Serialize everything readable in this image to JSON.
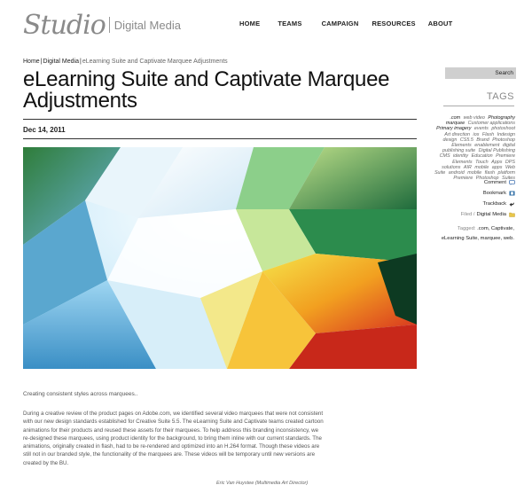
{
  "header": {
    "logo_script": "Studio",
    "logo_text": "Digital Media",
    "nav": [
      "HOME",
      "TEAMS",
      "CAMPAIGN",
      "RESOURCES",
      "ABOUT"
    ]
  },
  "breadcrumb": {
    "home": "Home",
    "section": "Digital Media",
    "current": "eLearning Suite and Captivate Marquee Adjustments"
  },
  "post": {
    "title": "eLearning Suite and Captivate Marquee Adjustments",
    "date": "Dec 14, 2011",
    "caption": "Creating consistent styles across marquees..",
    "body": "During a creative review of the product pages on Adobe.com, we identified several video marquees that were not consistent with our new design standards established for Creative Suite 5.5. The eLearning Suite and Captivate teams created cartoon animations for their products and reused these assets for their marquees. To help address this branding inconsistency, we re-designed these marquees, using product identity for the background, to bring them inline with our current standards. The animations, originally created in flash, had to be re-rendered and optimized into an H.264 format. Though these videos are still not in our branded style, the functionality of the marquees are. These videos will be temporary until new versions are created by the BU.",
    "credit": "Eric Van Huystee (Multimedia Art Director)"
  },
  "sidebar": {
    "search_label": "Search",
    "search_placeholder": "",
    "tags_heading": "TAGS",
    "tags": [
      {
        "t": ".com",
        "em": true
      },
      {
        "t": "web video",
        "em": false
      },
      {
        "t": "Photography",
        "em": true
      },
      {
        "t": "marquee",
        "em": true
      },
      {
        "t": "Customer applications",
        "em": false
      },
      {
        "t": "Primary imagery",
        "em": true
      },
      {
        "t": "events",
        "em": false
      },
      {
        "t": "photoshoot",
        "em": false
      },
      {
        "t": "Art direction",
        "em": false
      },
      {
        "t": "ios",
        "em": false
      },
      {
        "t": "Flash",
        "em": false
      },
      {
        "t": "Indesign",
        "em": false
      },
      {
        "t": "design",
        "em": false
      },
      {
        "t": "CS5.5",
        "em": false
      },
      {
        "t": "Brand",
        "em": false
      },
      {
        "t": "Photoshop Elements",
        "em": false
      },
      {
        "t": "enablement",
        "em": false
      },
      {
        "t": "digital publishing suite",
        "em": false
      },
      {
        "t": "Digital Publishing",
        "em": false
      },
      {
        "t": "CMS",
        "em": false
      },
      {
        "t": "identity",
        "em": false
      },
      {
        "t": "Education",
        "em": false
      },
      {
        "t": "Premiere Elements",
        "em": false
      },
      {
        "t": "Touch",
        "em": false
      },
      {
        "t": "Apps",
        "em": false
      },
      {
        "t": "DPS",
        "em": false
      },
      {
        "t": "solutions",
        "em": false
      },
      {
        "t": "AIR",
        "em": false
      },
      {
        "t": "mobile",
        "em": false
      },
      {
        "t": "apps",
        "em": false
      },
      {
        "t": "Web Suite",
        "em": false
      },
      {
        "t": "android",
        "em": false
      },
      {
        "t": "mobile",
        "em": false
      },
      {
        "t": "flash",
        "em": false
      },
      {
        "t": "platform",
        "em": false
      },
      {
        "t": "Premiere",
        "em": false
      },
      {
        "t": "Photoshop",
        "em": false
      },
      {
        "t": "Suites",
        "em": false
      }
    ],
    "comment": "Comment",
    "bookmark": "Bookmark",
    "trackback": "Trackback",
    "filed_prefix": "Filed /",
    "filed_value": "Digital Media",
    "tagged_prefix": "Tagged:",
    "tagged_values": ".com, Captivate, eLearning Suite, marquee, web."
  },
  "colors": {
    "accent_comment": "#4a78b4",
    "accent_bookmark": "#2e6da4",
    "accent_folder": "#e8c64a"
  }
}
